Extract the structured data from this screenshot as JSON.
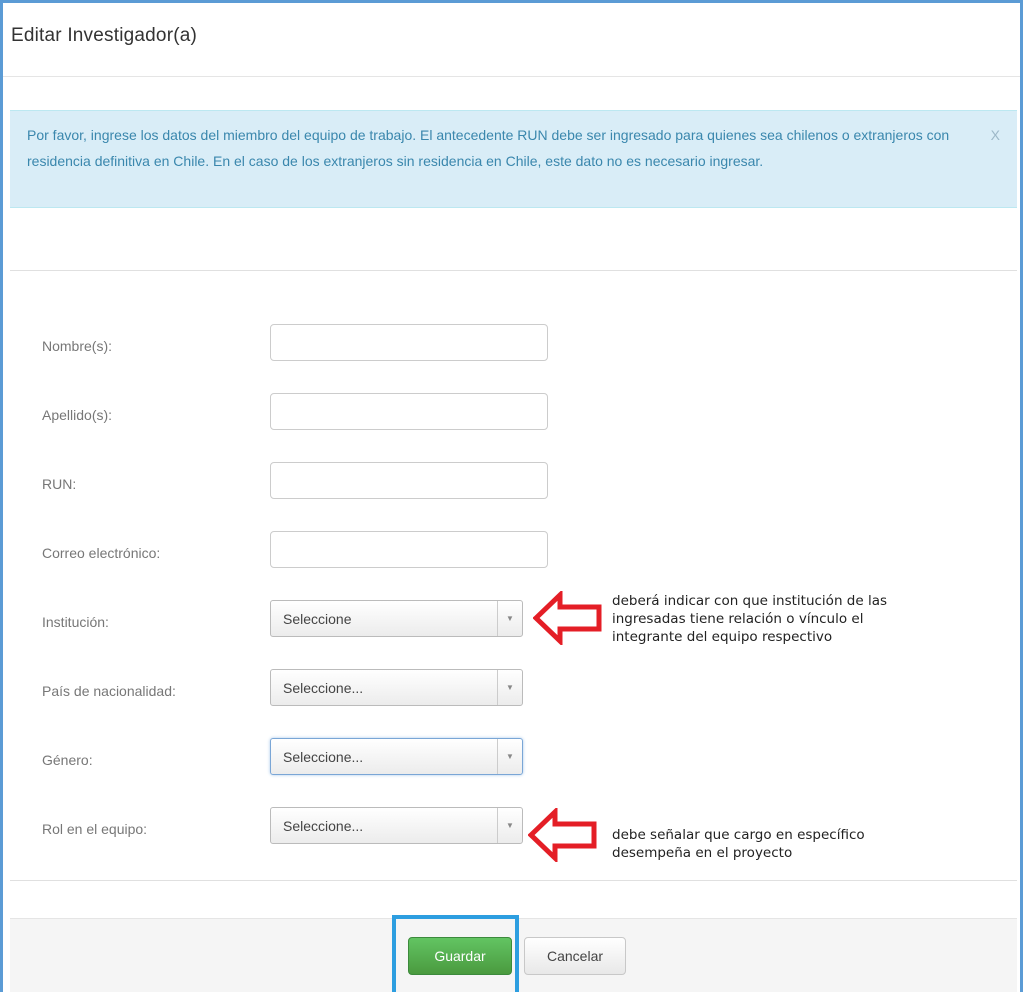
{
  "modal": {
    "title": "Editar Investigador(a)"
  },
  "alert": {
    "text": "Por favor, ingrese los datos del miembro del equipo de trabajo. El antecedente RUN debe ser ingresado para quienes sea chilenos o extranjeros con residencia definitiva en Chile. En el caso de los extranjeros sin residencia en Chile, este dato no es necesario ingresar.",
    "close": "X"
  },
  "form": {
    "nombre_label": "Nombre(s):",
    "apellido_label": "Apellido(s):",
    "run_label": "RUN:",
    "correo_label": "Correo electrónico:",
    "institucion_label": "Institución:",
    "institucion_value": "Seleccione",
    "pais_label": "País de nacionalidad:",
    "pais_value": "Seleccione...",
    "genero_label": "Género:",
    "genero_value": "Seleccione...",
    "rol_label": "Rol en el equipo:",
    "rol_value": "Seleccione..."
  },
  "annotations": {
    "institucion_note": [
      "deberá indicar con que institución de las",
      "ingresadas tiene relación o vínculo el",
      "integrante del equipo respectivo"
    ],
    "rol_note": [
      "debe señalar que cargo en específico",
      "desempeña en el proyecto"
    ],
    "arrow_color": "#e41e26",
    "highlight_color": "#2d9ee0"
  },
  "footer": {
    "save_label": "Guardar",
    "cancel_label": "Cancelar"
  }
}
